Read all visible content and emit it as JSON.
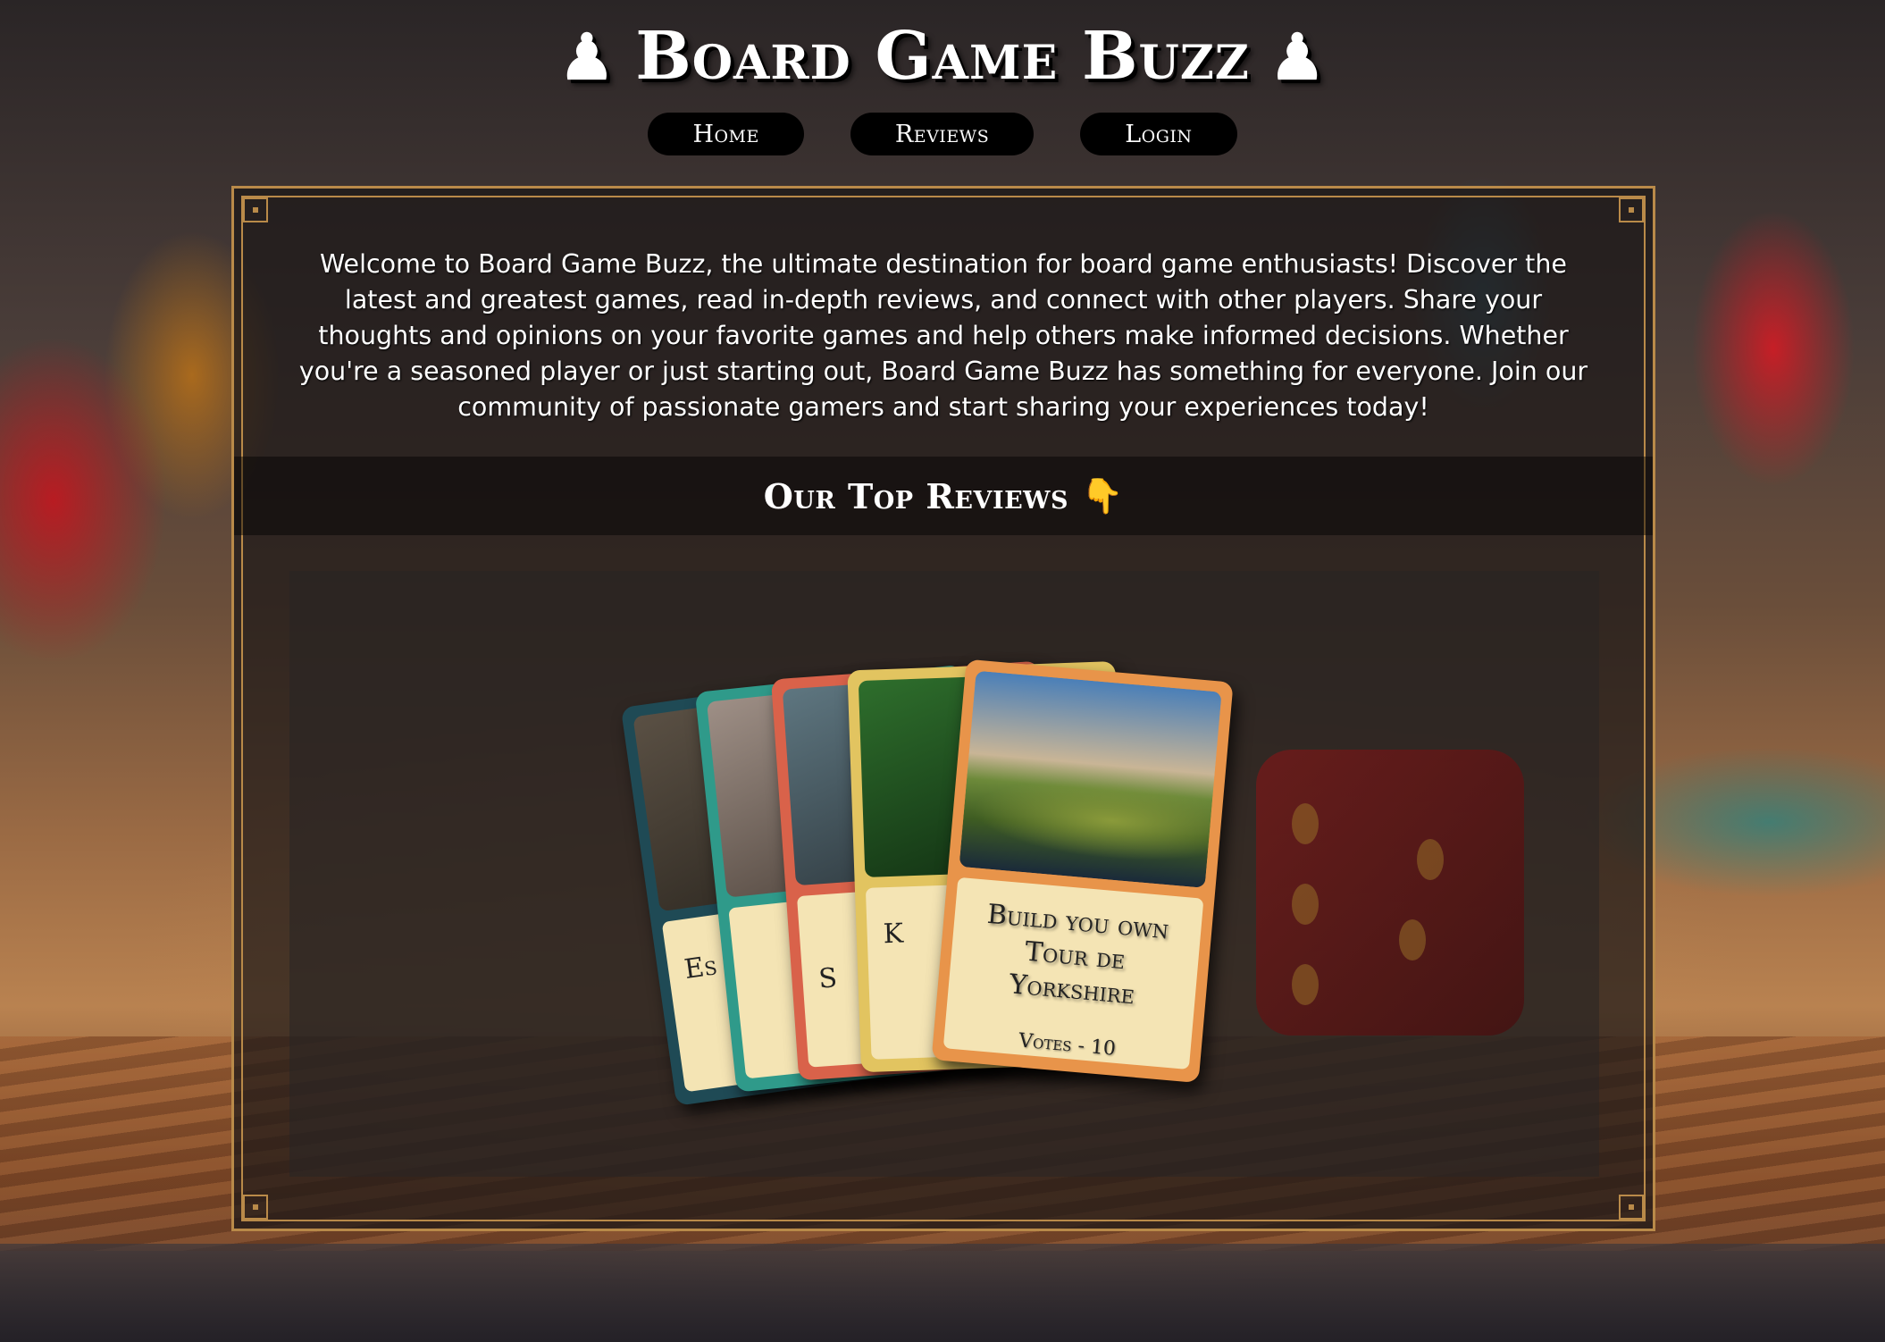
{
  "site": {
    "title": "Board Game Buzz",
    "title_icon": "chess-pawn-icon"
  },
  "nav": {
    "items": [
      {
        "label": "Home"
      },
      {
        "label": "Reviews"
      },
      {
        "label": "Login"
      }
    ]
  },
  "intro": {
    "text": "Welcome to Board Game Buzz, the ultimate destination for board game enthusiasts! Discover the latest and greatest games, read in-depth reviews, and connect with other players. Share your thoughts and opinions on your favorite games and help others make informed decisions. Whether you're a seasoned player or just starting out, Board Game Buzz has something for everyone. Join our community of passionate gamers and start sharing your experiences today!"
  },
  "top_reviews": {
    "heading": "Our Top Reviews",
    "heading_icon": "pointing-down-icon",
    "cards": [
      {
        "title_visible": "Es",
        "color": "#1f4a55"
      },
      {
        "title_visible": "",
        "color": "#2f9a8a"
      },
      {
        "title_visible": "S",
        "color": "#d9624a"
      },
      {
        "title_visible": "K",
        "color": "#e2c460"
      },
      {
        "title": "Build you own Tour de Yorkshire",
        "votes": "Votes - 10",
        "color": "#e8944a"
      }
    ]
  },
  "colors": {
    "frame_gold": "#b98a49",
    "nav_bg": "#000000",
    "card_body": "#f4e4b4"
  }
}
